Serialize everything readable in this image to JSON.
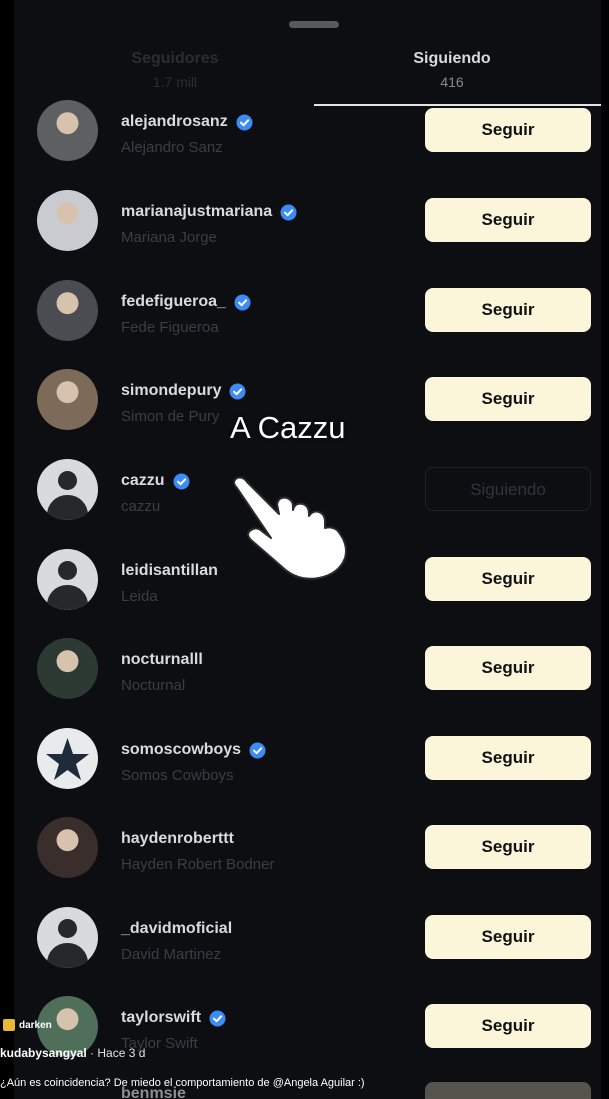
{
  "tabs": {
    "followers": {
      "title": "Seguidores",
      "count": "1.7 mill"
    },
    "following": {
      "title": "Siguiendo",
      "count": "416"
    }
  },
  "colors": {
    "background": "#0d0e12",
    "follow_button": "#fbf5da",
    "verified": "#3d8bf5"
  },
  "rows": [
    {
      "username": "alejandrosanz",
      "fullname": "Alejandro Sanz",
      "verified": true,
      "button": "Seguir",
      "avatar": "photo"
    },
    {
      "username": "marianajustmariana",
      "fullname": "Mariana Jorge",
      "verified": true,
      "button": "Seguir",
      "avatar": "photo"
    },
    {
      "username": "fedefigueroa_",
      "fullname": "Fede Figueroa",
      "verified": true,
      "button": "Seguir",
      "avatar": "photo"
    },
    {
      "username": "simondepury",
      "fullname": "Simon de Pury",
      "verified": true,
      "button": "Seguir",
      "avatar": "photo"
    },
    {
      "username": "cazzu",
      "fullname": "cazzu",
      "verified": true,
      "button": "Siguiendo",
      "avatar": "default"
    },
    {
      "username": "leidisantillan",
      "fullname": "Leida",
      "verified": false,
      "button": "Seguir",
      "avatar": "default"
    },
    {
      "username": "nocturnalll",
      "fullname": "Nocturnal",
      "verified": false,
      "button": "Seguir",
      "avatar": "photo"
    },
    {
      "username": "somoscowboys",
      "fullname": "Somos Cowboys",
      "verified": true,
      "button": "Seguir",
      "avatar": "star-logo"
    },
    {
      "username": "haydenroberttt",
      "fullname": "Hayden Robert Bodner",
      "verified": false,
      "button": "Seguir",
      "avatar": "photo"
    },
    {
      "username": "_davidmoficial",
      "fullname": "David Martinez",
      "verified": false,
      "button": "Seguir",
      "avatar": "default"
    },
    {
      "username": "taylorswift",
      "fullname": "Taylor Swift",
      "verified": true,
      "button": "Seguir",
      "avatar": "photo"
    }
  ],
  "partial_row": {
    "username": "benmsie"
  },
  "overlay": {
    "label": "A Cazzu",
    "pointer": "pointing-hand-icon"
  },
  "post": {
    "tag": "darken",
    "author": "kudabysangyal",
    "time": "· Hace 3 d",
    "caption": "¿Aún es coincidencia? De miedo el comportamiento de @Angela Aguilar :)"
  }
}
